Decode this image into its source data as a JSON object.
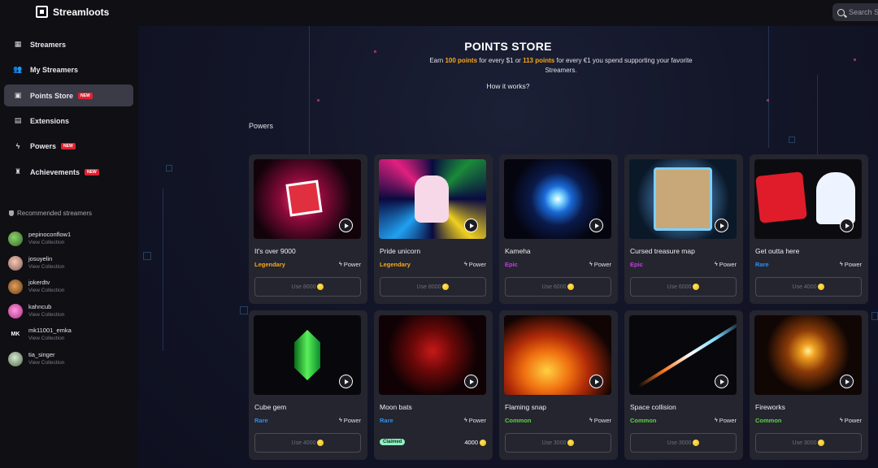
{
  "app": {
    "name": "Streamloots"
  },
  "search": {
    "placeholder": "Search St"
  },
  "sidebar": {
    "items": [
      {
        "label": "Streamers",
        "icon": "grid-icon",
        "badge": "",
        "active": false
      },
      {
        "label": "My Streamers",
        "icon": "people-icon",
        "badge": "",
        "active": false
      },
      {
        "label": "Points Store",
        "icon": "store-icon",
        "badge": "NEW",
        "active": true
      },
      {
        "label": "Extensions",
        "icon": "extensions-icon",
        "badge": "",
        "active": false
      },
      {
        "label": "Powers",
        "icon": "bolt-icon",
        "badge": "NEW",
        "active": false
      },
      {
        "label": "Achievements",
        "icon": "medal-icon",
        "badge": "NEW",
        "active": false
      }
    ],
    "recommended_title": "Recommended streamers",
    "streamers": [
      {
        "name": "pepinoconflow1",
        "sub": "View Collection"
      },
      {
        "name": "josuyelin",
        "sub": "View Collection"
      },
      {
        "name": "jokerdtv",
        "sub": "View Collection"
      },
      {
        "name": "kahncub",
        "sub": "View Collection"
      },
      {
        "name": "mk11001_emka",
        "sub": "View Collection"
      },
      {
        "name": "tia_singer",
        "sub": "View Collection"
      }
    ]
  },
  "main": {
    "title": "POINTS STORE",
    "subtitle_parts": [
      "Earn ",
      "100 points",
      " for every $1 or ",
      "113 points",
      " for every €1 you spend supporting your favorite Streamers."
    ],
    "how_it_works": "How it works?",
    "section": "Powers"
  },
  "cards": [
    {
      "name": "It's over 9000",
      "rarity": "Legendary",
      "type": "Power",
      "cost": "Use 8000",
      "claimed": false,
      "claimed_label": "",
      "claimed_cost": ""
    },
    {
      "name": "Pride unicorn",
      "rarity": "Legendary",
      "type": "Power",
      "cost": "Use 8000",
      "claimed": false,
      "claimed_label": "",
      "claimed_cost": ""
    },
    {
      "name": "Kameha",
      "rarity": "Epic",
      "type": "Power",
      "cost": "Use 6000",
      "claimed": false,
      "claimed_label": "",
      "claimed_cost": ""
    },
    {
      "name": "Cursed treasure map",
      "rarity": "Epic",
      "type": "Power",
      "cost": "Use 6000",
      "claimed": false,
      "claimed_label": "",
      "claimed_cost": ""
    },
    {
      "name": "Get outta here",
      "rarity": "Rare",
      "type": "Power",
      "cost": "Use 4000",
      "claimed": false,
      "claimed_label": "",
      "claimed_cost": ""
    },
    {
      "name": "Cube gem",
      "rarity": "Rare",
      "type": "Power",
      "cost": "Use 4000",
      "claimed": false,
      "claimed_label": "",
      "claimed_cost": ""
    },
    {
      "name": "Moon bats",
      "rarity": "Rare",
      "type": "Power",
      "cost": "",
      "claimed": true,
      "claimed_label": "Claimed",
      "claimed_cost": "4000"
    },
    {
      "name": "Flaming snap",
      "rarity": "Common",
      "type": "Power",
      "cost": "Use 3000",
      "claimed": false,
      "claimed_label": "",
      "claimed_cost": ""
    },
    {
      "name": "Space collision",
      "rarity": "Common",
      "type": "Power",
      "cost": "Use 3000",
      "claimed": false,
      "claimed_label": "",
      "claimed_cost": ""
    },
    {
      "name": "Fireworks",
      "rarity": "Common",
      "type": "Power",
      "cost": "Use 3000",
      "claimed": false,
      "claimed_label": "",
      "claimed_cost": ""
    }
  ],
  "colors": {
    "legendary": "#f7a81b",
    "epic": "#c43ee0",
    "rare": "#2f8ff0",
    "common": "#5ed341",
    "highlight": "#f7a81b",
    "badge_new": "#e02132",
    "claimed_badge": "#8ff0c0"
  }
}
